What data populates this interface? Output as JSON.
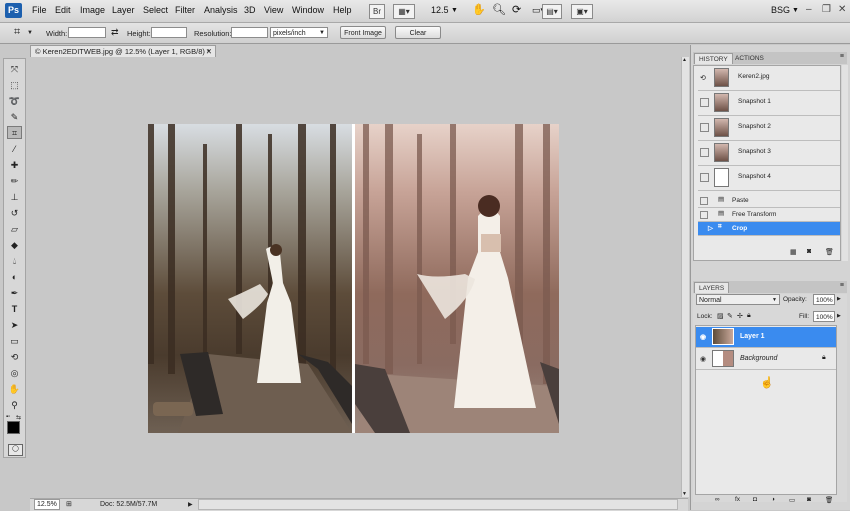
{
  "app": {
    "logo": "Ps"
  },
  "menu": [
    "File",
    "Edit",
    "Image",
    "Layer",
    "Select",
    "Filter",
    "Analysis",
    "3D",
    "View",
    "Window",
    "Help"
  ],
  "menubar_right": {
    "zoom": "12.5",
    "workspace": "BSG"
  },
  "options": {
    "width_label": "Width:",
    "width_value": "",
    "height_label": "Height:",
    "height_value": "",
    "resolution_label": "Resolution:",
    "resolution_value": "",
    "unit": "pixels/inch",
    "front_image_label": "Front Image",
    "clear_label": "Clear"
  },
  "document": {
    "tab_title": "© Keren2EDITWEB.jpg @ 12.5% (Layer 1, RGB/8) *",
    "zoom": "12.5%",
    "doc_info": "Doc: 52.5M/57.7M"
  },
  "history": {
    "tabs": [
      "HISTORY",
      "ACTIONS"
    ],
    "snapshots": [
      "Keren2.jpg",
      "Snapshot 1",
      "Snapshot 2",
      "Snapshot 3",
      "Snapshot 4"
    ],
    "steps": [
      "Paste",
      "Free Transform",
      "Crop"
    ],
    "selected_step": "Crop"
  },
  "layers": {
    "tab": "LAYERS",
    "blend_mode": "Normal",
    "opacity_label": "Opacity:",
    "opacity": "100%",
    "lock_label": "Lock:",
    "fill_label": "Fill:",
    "fill": "100%",
    "items": [
      {
        "name": "Layer 1",
        "selected": true
      },
      {
        "name": "Background",
        "selected": false,
        "locked": true
      }
    ]
  },
  "colors": {
    "selection": "#3a8bef",
    "ps_blue": "#1c5fae"
  }
}
